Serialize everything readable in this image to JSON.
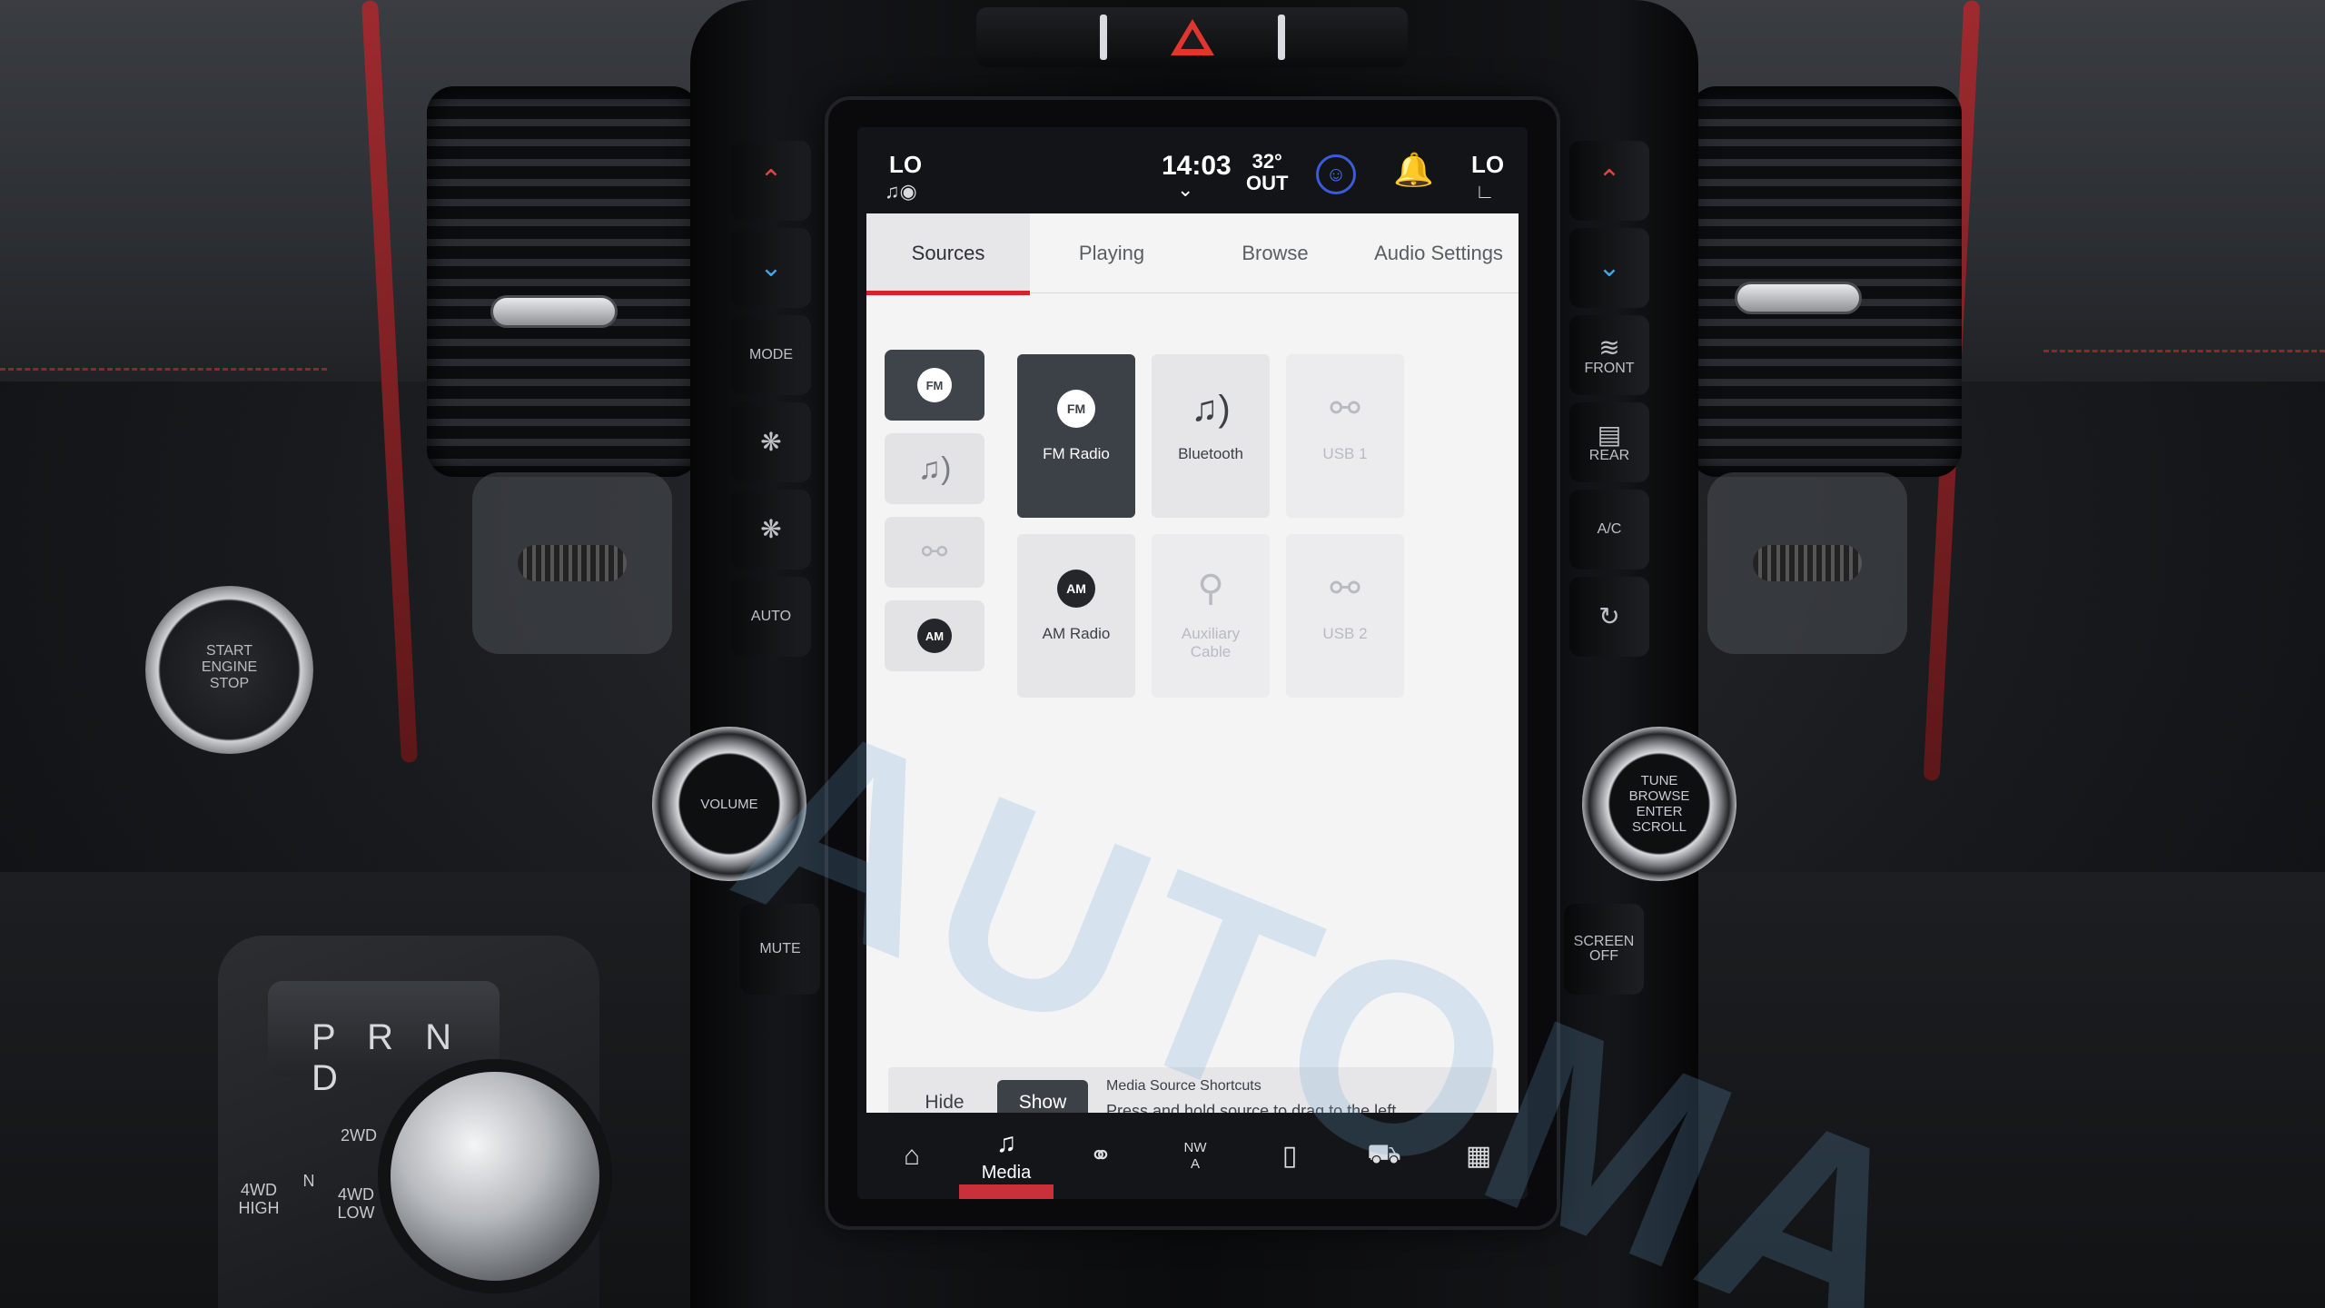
{
  "status_bar": {
    "left_temp": "LO",
    "time": "14:03",
    "outside_temp": "32°",
    "outside_label": "OUT",
    "right_temp": "LO"
  },
  "tabs": [
    {
      "label": "Sources",
      "active": true
    },
    {
      "label": "Playing",
      "active": false
    },
    {
      "label": "Browse",
      "active": false
    },
    {
      "label": "Audio Settings",
      "active": false
    }
  ],
  "shortcut_rail": [
    {
      "icon": "fm-radio-icon",
      "text": "FM",
      "active": true
    },
    {
      "icon": "bluetooth-audio-icon",
      "text": "",
      "active": false
    },
    {
      "icon": "usb-icon",
      "text": "",
      "active": false
    },
    {
      "icon": "am-radio-icon",
      "text": "AM",
      "active": false
    }
  ],
  "sources": [
    {
      "label": "FM Radio",
      "icon_text": "FM",
      "icon": "fm-radio-icon",
      "state": "active"
    },
    {
      "label": "Bluetooth",
      "icon_text": "",
      "icon": "bluetooth-audio-icon",
      "state": "normal"
    },
    {
      "label": "USB 1",
      "icon_text": "",
      "icon": "usb-icon",
      "state": "disabled"
    },
    {
      "label": "AM Radio",
      "icon_text": "AM",
      "icon": "am-radio-icon",
      "state": "normal"
    },
    {
      "label": "Auxiliary Cable",
      "icon_text": "",
      "icon": "aux-cable-icon",
      "state": "disabled"
    },
    {
      "label": "USB 2",
      "icon_text": "",
      "icon": "usb-icon",
      "state": "disabled"
    }
  ],
  "shortcut_bar": {
    "hide_label": "Hide",
    "show_label": "Show",
    "title": "Media Source Shortcuts",
    "description": "Press and hold source to drag to the left"
  },
  "bottom_nav": {
    "media_label": "Media",
    "compass_top": "NW",
    "compass_bottom": "A"
  },
  "hardware": {
    "mode": "MODE",
    "auto": "AUTO",
    "mute": "MUTE",
    "front": "FRONT",
    "rear": "REAR",
    "ac": "A/C",
    "screen_off": "SCREEN OFF",
    "volume": "VOLUME",
    "tune_knob": "TUNE BROWSE ENTER SCROLL",
    "start_stop": "START ENGINE STOP",
    "gear": "P R N D",
    "two_wd": "2WD",
    "four_wd_high": "4WD HIGH",
    "four_wd_low": "4WD LOW",
    "neutral": "N"
  },
  "watermark": "AUTOMA",
  "colors": {
    "accent_red": "#d4232b",
    "active_tile": "#3c4047",
    "profile_blue": "#3d5bd8"
  }
}
